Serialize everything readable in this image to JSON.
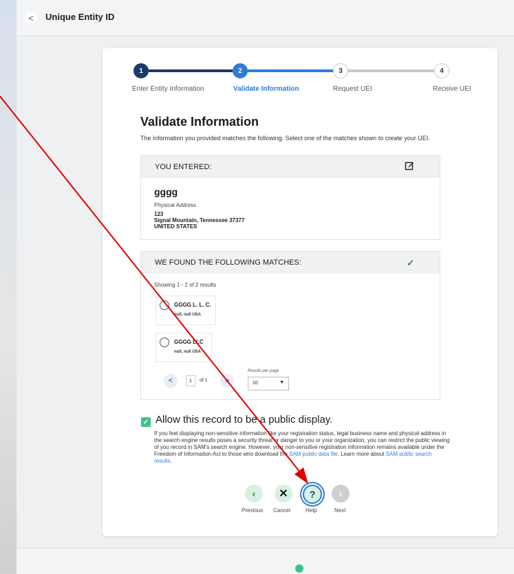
{
  "header": {
    "title": "Unique Entity ID",
    "back_label": "<"
  },
  "stepper": {
    "steps": [
      {
        "num": "1",
        "label": "Enter Entity Information"
      },
      {
        "num": "2",
        "label": "Validate Information"
      },
      {
        "num": "3",
        "label": "Request UEI"
      },
      {
        "num": "4",
        "label": "Receive UEI"
      }
    ],
    "current_step": 2
  },
  "page": {
    "title": "Validate Information",
    "description": "The information you provided matches the following. Select one of the matches shown to create your UEI."
  },
  "entered": {
    "header": "YOU ENTERED:",
    "name": "gggg",
    "address_label": "Physical Address",
    "address_line1": "123",
    "address_line2": "Signal Mountain, Tennessee 37377",
    "address_line3": "UNITED STATES"
  },
  "matches": {
    "header": "WE FOUND THE FOLLOWING MATCHES:",
    "showing": "Showing 1 - 2 of 2 results",
    "items": [
      {
        "name": "GGGG L. L. C.",
        "location": "null, null USA"
      },
      {
        "name": "GGGG LLC",
        "location": "null, null USA"
      }
    ],
    "pager": {
      "page": "1",
      "of_text": "of 1",
      "prev": "<",
      "next": ">"
    },
    "results_per_page_label": "Results per page",
    "results_per_page": "10"
  },
  "public": {
    "title": "Allow this record to be a public display.",
    "body_1": "If you feel displaying non-sensitive information like your registration status, legal business name and physical address in the search engine results poses a security threat or danger to you or your organization, you can restrict the public viewing of you record in SAM's search engine. However, your non-sensitive registration information remains available under the Freedom of Information Act to those who download the ",
    "link_1": "SAM public data file",
    "body_2": ". Learn more about ",
    "link_2": "SAM public search results",
    "body_3": "."
  },
  "nav": {
    "previous": "Previous",
    "cancel": "Cancel",
    "help": "Help",
    "next": "Next"
  },
  "colors": {
    "step_done": "#1a3a6b",
    "step_active": "#2f7bd8",
    "success": "#2e8540",
    "annotation_arrow": "#e00000"
  }
}
